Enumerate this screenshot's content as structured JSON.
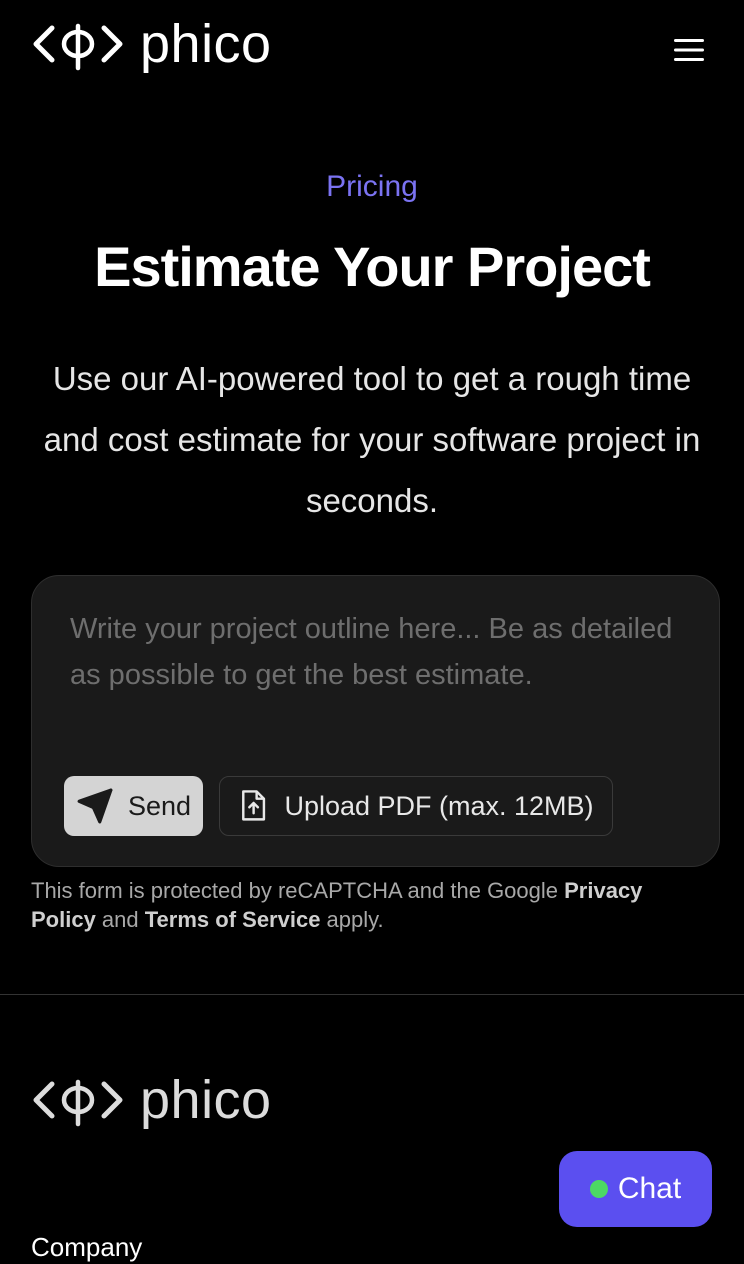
{
  "brand": {
    "name": "phico"
  },
  "header": {
    "menu_icon": "hamburger-icon"
  },
  "hero": {
    "eyebrow": "Pricing",
    "title": "Estimate Your Project",
    "subtitle": "Use our AI-powered tool to get a rough time and cost estimate for your software project in seconds."
  },
  "form": {
    "outline_value": "",
    "outline_placeholder": "Write your project outline here... Be as detailed as possible to get the best estimate.",
    "send_label": "Send",
    "send_icon": "paper-plane-icon",
    "upload_label": "Upload PDF (max. 12MB)",
    "upload_icon": "file-upload-icon"
  },
  "recaptcha": {
    "prefix": "This form is protected by reCAPTCHA and the Google ",
    "privacy_link": "Privacy Policy",
    "middle": " and ",
    "terms_link": "Terms of Service",
    "suffix": " apply."
  },
  "footer": {
    "brand_name": "phico",
    "company_heading": "Company"
  },
  "chat": {
    "label": "Chat",
    "status": "online"
  },
  "colors": {
    "background": "#000000",
    "accent": "#7b73f2",
    "chat_button": "#5b4ff0",
    "status_online": "#4cd964",
    "card": "#1a1a1a",
    "send_button": "#d4d4d4"
  }
}
